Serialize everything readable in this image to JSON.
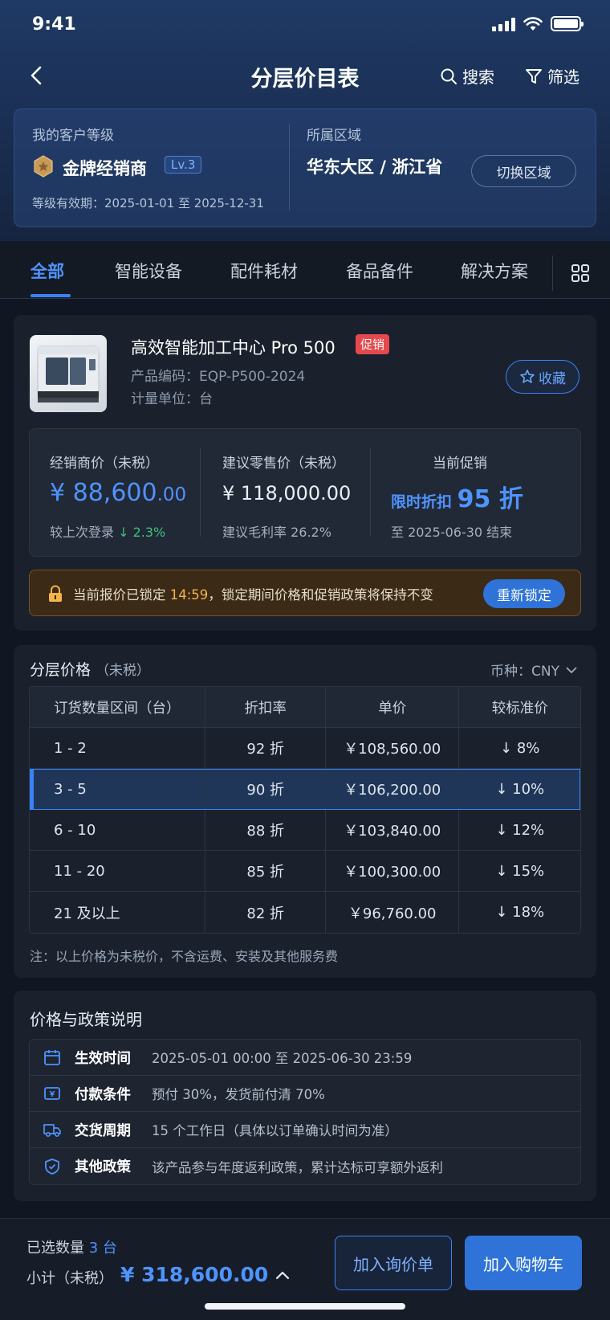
{
  "status": {
    "time": "9:41"
  },
  "nav": {
    "title": "分层价目表",
    "search_label": "搜索",
    "filter_label": "筛选"
  },
  "customer": {
    "level_label": "我的客户等级",
    "level_name": "金牌经销商",
    "level_tag": "Lv.3",
    "validity": "等级有效期：2025-01-01 至 2025-12-31",
    "region_label": "所属区域",
    "region_value": "华东大区 / 浙江省",
    "switch_label": "切换区域"
  },
  "tabs": [
    "全部",
    "智能设备",
    "配件耗材",
    "备品备件",
    "解决方案"
  ],
  "product": {
    "name": "高效智能加工中心 Pro 500",
    "promo_tag": "促销",
    "code": "产品编码：EQP-P500-2024",
    "unit": "计量单位：台",
    "fav_label": "收藏",
    "dealer_price_label": "经销商价（未税）",
    "dealer_price_main": "¥ 88,600",
    "dealer_price_dec": ".00",
    "dealer_change_prefix": "较上次登录 ",
    "dealer_change": "↓ 2.3%",
    "retail_label": "建议零售价（未税）",
    "retail_price": "¥ 118,000.00",
    "retail_margin": "建议毛利率 26.2%",
    "promo_label": "当前促销",
    "promo_text": "限时折扣 ",
    "promo_num": "95 折",
    "promo_end": "至 2025-06-30 结束",
    "lock_prefix": "当前报价已锁定 ",
    "lock_time": "14:59",
    "lock_suffix": "，锁定期间价格和促销政策将保持不变",
    "relock_label": "重新锁定"
  },
  "tier": {
    "title": "分层价格",
    "title_note": "（未税）",
    "currency": "币种：CNY",
    "headers": [
      "订货数量区间（台）",
      "折扣率",
      "单价",
      "较标准价"
    ],
    "rows": [
      [
        "1 - 2",
        "92 折",
        "￥108,560.00",
        "↓ 8%"
      ],
      [
        "3 - 5",
        "90 折",
        "￥106,200.00",
        "↓ 10%"
      ],
      [
        "6 - 10",
        "88 折",
        "￥103,840.00",
        "↓ 12%"
      ],
      [
        "11 - 20",
        "85 折",
        "￥100,300.00",
        "↓ 15%"
      ],
      [
        "21 及以上",
        "82 折",
        "￥96,760.00",
        "↓ 18%"
      ]
    ],
    "selected_row": 1,
    "note": "注：以上价格为未税价，不含运费、安装及其他服务费"
  },
  "policy": {
    "title": "价格与政策说明",
    "items": [
      {
        "icon": "calendar-icon",
        "key": "生效时间",
        "value": "2025-05-01 00:00 至 2025-06-30 23:59"
      },
      {
        "icon": "payment-icon",
        "key": "付款条件",
        "value": "预付 30%，发货前付清 70%"
      },
      {
        "icon": "truck-icon",
        "key": "交货周期",
        "value": "15 个工作日（具体以订单确认时间为准）"
      },
      {
        "icon": "shield-icon",
        "key": "其他政策",
        "value": "该产品参与年度返利政策，累计达标可享额外返利"
      }
    ]
  },
  "bottom": {
    "qty_prefix": "已选数量 ",
    "qty": "3 台",
    "subtotal_label": "小计（未税）",
    "subtotal": "¥ 318,600.00",
    "inquiry_label": "加入询价单",
    "cart_label": "加入购物车"
  },
  "colors": {
    "accent": "#3b82f6",
    "promo": "#e5484d",
    "positive": "#3fc07a",
    "lock_time": "#f5b546"
  }
}
